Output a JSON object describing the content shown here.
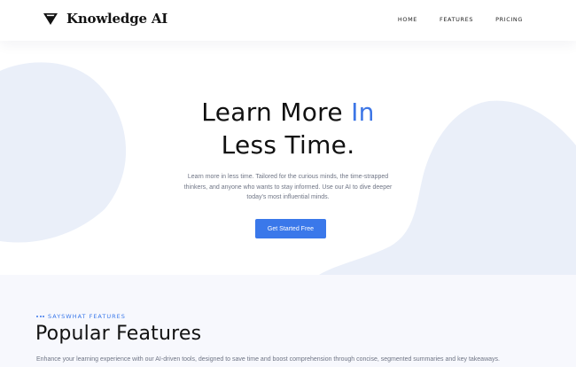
{
  "brand": {
    "name": "Knowledge AI",
    "icon": "triangle-shield-icon"
  },
  "nav": {
    "items": [
      {
        "label": "HOME"
      },
      {
        "label": "FEATURES"
      },
      {
        "label": "PRICING"
      }
    ]
  },
  "hero": {
    "title_part1": "Learn More ",
    "title_accent": "In",
    "title_line2": "Less Time.",
    "description": "Learn more in less time. Tailored for the curious minds, the time-strapped thinkers, and anyone who wants to stay informed. Use our AI to dive deeper today's most influential minds.",
    "cta_label": "Get Started Free"
  },
  "features": {
    "eyebrow": "SAYSWHAT FEATURES",
    "title": "Popular Features",
    "description": "Enhance your learning experience with our AI-driven tools, designed to save time and boost comprehension through concise, segmented summaries and key takeaways."
  },
  "colors": {
    "accent": "#3a78ea",
    "blob": "#eaeff9",
    "section_bg": "#f7f8fd"
  }
}
